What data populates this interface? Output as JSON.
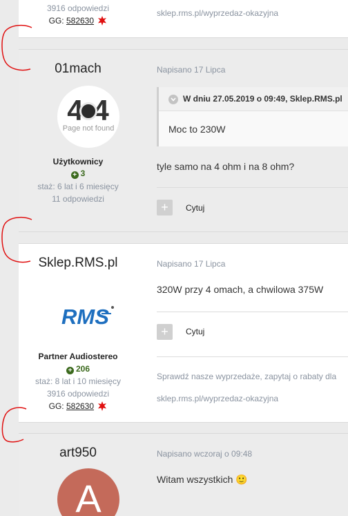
{
  "prev_post": {
    "replies": "3916 odpowiedzi",
    "gg_label": "GG:",
    "gg_number": "582630",
    "signature_link": "sklep.rms.pl/wyprzedaz-okazyjna"
  },
  "post1": {
    "username": "01mach",
    "avatar_text_big": "4 4",
    "avatar_text_small": "Page not found",
    "rank": "Użytkownicy",
    "reputation": "3",
    "tenure": "staż: 6 lat i 6 miesięcy",
    "replies": "11 odpowiedzi",
    "posted": "Napisano 17 Lipca",
    "quote_header": "W dniu 27.05.2019 o 09:49, Sklep.RMS.pl",
    "quote_text": "Moc to 230W",
    "text": "tyle samo na 4 ohm i na 8 ohm?",
    "cite": "Cytuj"
  },
  "post2": {
    "username": "Sklep.RMS.pl",
    "logo_text": "RMS",
    "rank": "Partner Audiostereo",
    "reputation": "206",
    "tenure": "staż: 8 lat i 10 miesięcy",
    "replies": "3916 odpowiedzi",
    "gg_label": "GG:",
    "gg_number": "582630",
    "posted": "Napisano 17 Lipca",
    "text": "320W przy 4 omach, a chwilowa 375W",
    "cite": "Cytuj",
    "signature_text": "Sprawdź nasze wyprzedaże, zapytaj o rabaty dla",
    "signature_link": "sklep.rms.pl/wyprzedaz-okazyjna"
  },
  "post3": {
    "username": "art950",
    "avatar_letter": "A",
    "posted": "Napisano wczoraj o 09:48",
    "text": "Witam wszystkich",
    "emoji": "🙂"
  },
  "colors": {
    "reputation": "#3c6a1e",
    "annotation": "#e01010",
    "avatar_a": "#c46a5a",
    "rms_blue": "#1e6fbf"
  }
}
